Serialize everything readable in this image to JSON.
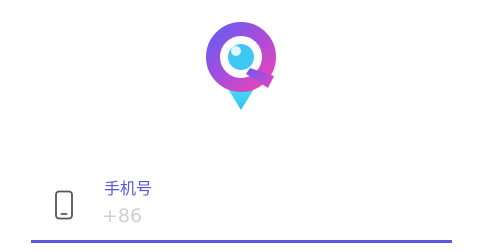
{
  "logo": {
    "icon": "location-search-pin-icon"
  },
  "phone_field": {
    "icon": "mobile-phone-icon",
    "label": "手机号",
    "value": "",
    "placeholder": "+86",
    "accent_color": "#5e56e0"
  }
}
